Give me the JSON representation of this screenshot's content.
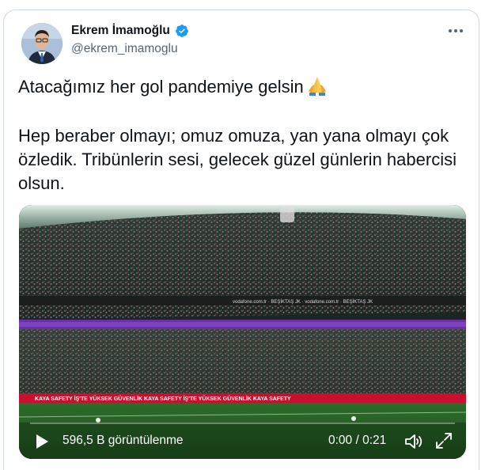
{
  "author": {
    "name": "Ekrem İmamoğlu",
    "handle": "@ekrem_imamoglu",
    "verified": true
  },
  "tweet": {
    "line1": "Atacağımız her gol pandemiye gelsin",
    "line1_emoji": "folded-hands-emoji",
    "paragraph2": "Hep beraber olmayı; omuz omuza, yan yana olmayı çok özledik. Tribünlerin sesi, gelecek güzel günlerin habercisi olsun."
  },
  "video": {
    "views": "596,5 B görüntülenme",
    "time": "0:00 / 0:21",
    "progress_fraction": 0,
    "stadium_banners": [
      "KAYA SAFETY",
      "İŞ'TE YÜKSEK GÜVENLİK",
      "vodafone.com.tr",
      "BEŞİKTAŞ JK"
    ]
  },
  "colors": {
    "text": "#0f1419",
    "secondary": "#536471",
    "verified": "#1d9bf0",
    "border": "#cfd9de"
  },
  "icons": {
    "more": "more-horizontal-icon",
    "play": "play-icon",
    "volume": "volume-icon",
    "fullscreen": "fullscreen-icon",
    "verified": "verified-badge-icon"
  }
}
